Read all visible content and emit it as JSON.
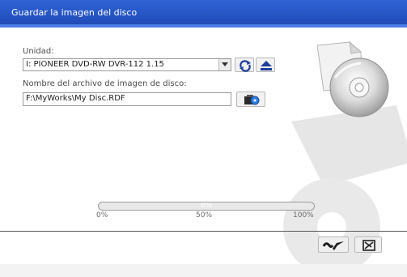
{
  "window": {
    "title": "Guardar la imagen del disco"
  },
  "drive": {
    "label": "Unidad:",
    "selected": "I: PIONEER DVD-RW  DVR-112 1.15"
  },
  "file": {
    "label": "Nombre del archivo de imagen de disco:",
    "path": "F:\\MyWorks\\My Disc.RDF"
  },
  "progress": {
    "value_percent": 0,
    "label": "0%",
    "ticks": [
      "0%",
      "50%",
      "100%"
    ]
  },
  "colors": {
    "title_bar": "#1f48b4",
    "progress_fill": "#8fb0e8"
  },
  "icons": {
    "drive_dropdown": "chevron-down-icon",
    "refresh": "refresh-icon",
    "eject": "eject-icon",
    "browse": "browse-folder-icon",
    "confirm": "checkmark-icon",
    "cancel": "cancel-icon",
    "disc_illustration": "disc-icon"
  }
}
